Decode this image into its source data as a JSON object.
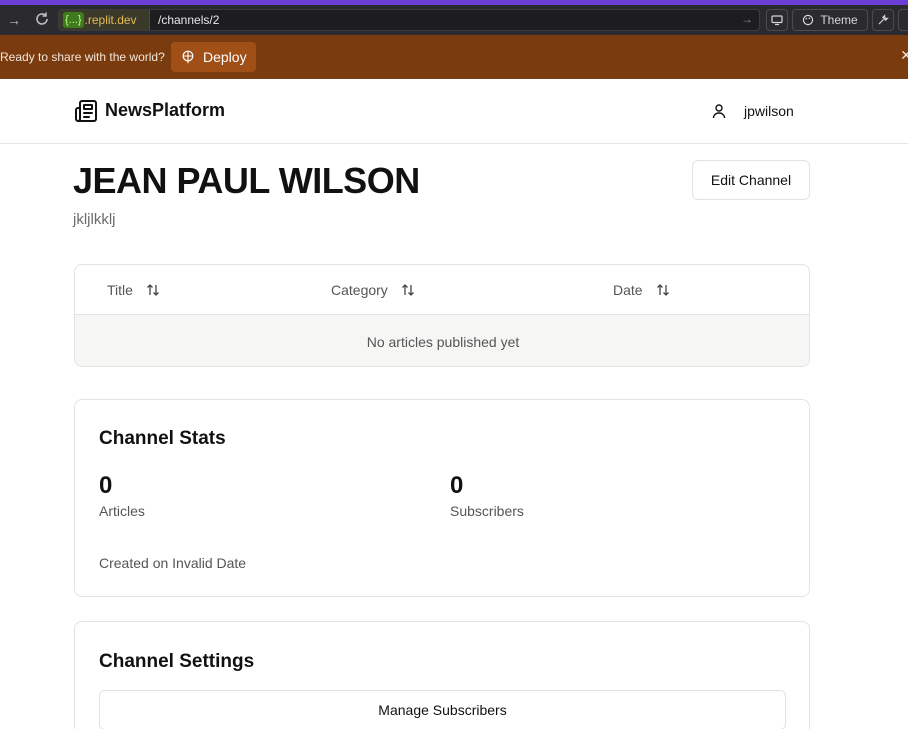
{
  "browser": {
    "url_brace": "{...}",
    "url_domain": ".replit.dev",
    "url_path": "/channels/2",
    "theme_label": "Theme"
  },
  "deploy_banner": {
    "text": "Ready to share with the world?",
    "button_label": "Deploy"
  },
  "header": {
    "logo_text": "NewsPlatform",
    "username": "jpwilson"
  },
  "channel": {
    "title": "JEAN PAUL WILSON",
    "description": "jkljlkklj",
    "edit_label": "Edit Channel"
  },
  "articles_table": {
    "columns": [
      "Title",
      "Category",
      "Date"
    ],
    "empty_message": "No articles published yet"
  },
  "stats": {
    "heading": "Channel Stats",
    "articles_value": "0",
    "articles_label": "Articles",
    "subscribers_value": "0",
    "subscribers_label": "Subscribers",
    "created_text": "Created on Invalid Date"
  },
  "settings": {
    "heading": "Channel Settings",
    "manage_label": "Manage Subscribers"
  },
  "colors": {
    "accent_strip": "#6b3fd6",
    "deploy_banner": "#7a3b0e",
    "deploy_button": "#a04f17"
  }
}
